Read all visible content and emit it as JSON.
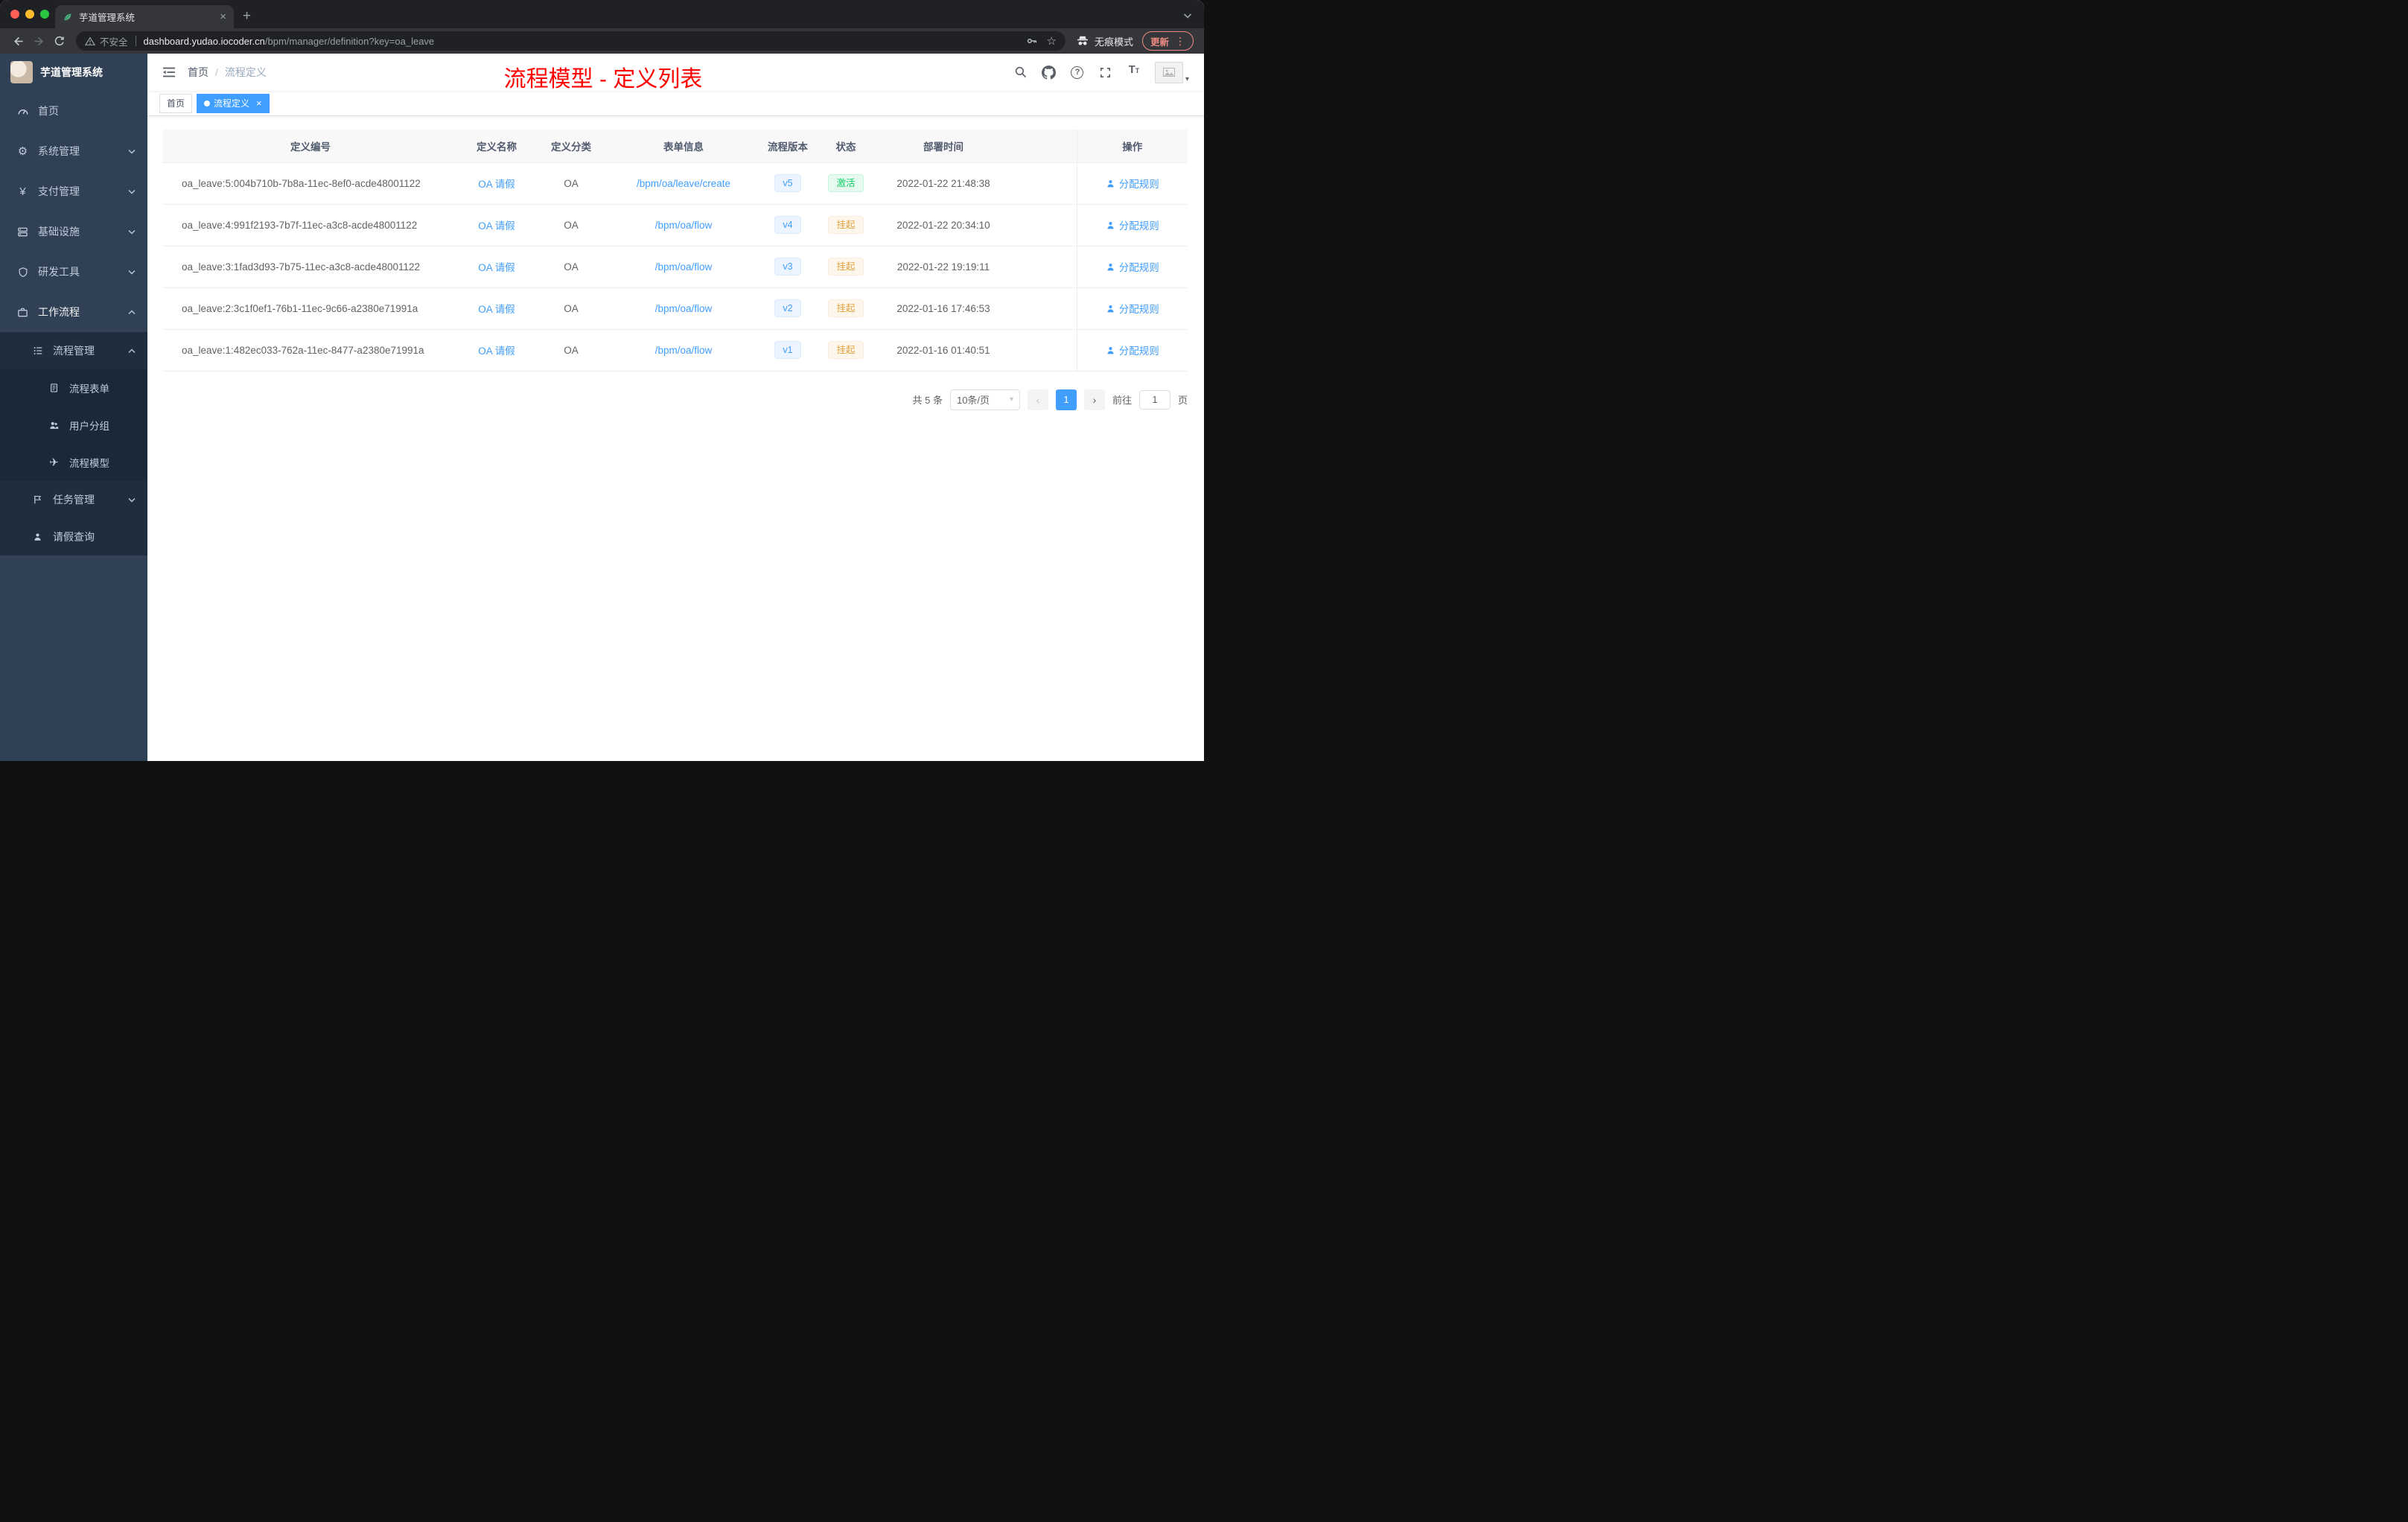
{
  "browser": {
    "tab_title": "芋道管理系统",
    "security_label": "不安全",
    "url_host": "dashboard.yudao.iocoder.cn",
    "url_path": "/bpm/manager/definition?key=oa_leave",
    "incognito_label": "无痕模式",
    "update_label": "更新"
  },
  "sidebar": {
    "logo_title": "芋道管理系统",
    "items": [
      {
        "label": "首页"
      },
      {
        "label": "系统管理"
      },
      {
        "label": "支付管理"
      },
      {
        "label": "基础设施"
      },
      {
        "label": "研发工具"
      },
      {
        "label": "工作流程"
      },
      {
        "label": "流程管理"
      },
      {
        "label": "流程表单"
      },
      {
        "label": "用户分组"
      },
      {
        "label": "流程模型"
      },
      {
        "label": "任务管理"
      },
      {
        "label": "请假查询"
      }
    ]
  },
  "header": {
    "breadcrumb_home": "首页",
    "breadcrumb_separator": "/",
    "breadcrumb_current": "流程定义",
    "overlay_title": "流程模型 - 定义列表"
  },
  "tags": {
    "home": "首页",
    "active": "流程定义"
  },
  "table": {
    "columns": [
      "定义编号",
      "定义名称",
      "定义分类",
      "表单信息",
      "流程版本",
      "状态",
      "部署时间",
      "操作"
    ],
    "rows": [
      {
        "id": "oa_leave:5:004b710b-7b8a-11ec-8ef0-acde48001122",
        "name": "OA 请假",
        "category": "OA",
        "form": "/bpm/oa/leave/create",
        "version": "v5",
        "status": "激活",
        "status_type": "success",
        "time": "2022-01-22 21:48:38",
        "action": "分配规则"
      },
      {
        "id": "oa_leave:4:991f2193-7b7f-11ec-a3c8-acde48001122",
        "name": "OA 请假",
        "category": "OA",
        "form": "/bpm/oa/flow",
        "version": "v4",
        "status": "挂起",
        "status_type": "warning",
        "time": "2022-01-22 20:34:10",
        "action": "分配规则"
      },
      {
        "id": "oa_leave:3:1fad3d93-7b75-11ec-a3c8-acde48001122",
        "name": "OA 请假",
        "category": "OA",
        "form": "/bpm/oa/flow",
        "version": "v3",
        "status": "挂起",
        "status_type": "warning",
        "time": "2022-01-22 19:19:11",
        "action": "分配规则"
      },
      {
        "id": "oa_leave:2:3c1f0ef1-76b1-11ec-9c66-a2380e71991a",
        "name": "OA 请假",
        "category": "OA",
        "form": "/bpm/oa/flow",
        "version": "v2",
        "status": "挂起",
        "status_type": "warning",
        "time": "2022-01-16 17:46:53",
        "action": "分配规则"
      },
      {
        "id": "oa_leave:1:482ec033-762a-11ec-8477-a2380e71991a",
        "name": "OA 请假",
        "category": "OA",
        "form": "/bpm/oa/flow",
        "version": "v1",
        "status": "挂起",
        "status_type": "warning",
        "time": "2022-01-16 01:40:51",
        "action": "分配规则"
      }
    ]
  },
  "pagination": {
    "total_label": "共 5 条",
    "page_size": "10条/页",
    "current": "1",
    "goto_label": "前往",
    "goto_value": "1",
    "page_label": "页"
  },
  "icons": {
    "close_tab": "×",
    "new_tab": "+",
    "star": "☆",
    "menu_dots": "⋮",
    "gear": "⚙",
    "yen": "¥",
    "send": "✈",
    "caret_down": "▾",
    "prev": "‹",
    "next": "›",
    "help": "?",
    "close_tag": "×"
  },
  "colors": {
    "accent": "#409eff",
    "success": "#13ce66",
    "warning": "#e6a23c",
    "title_red": "#ff0000",
    "sidebar_bg": "#304156",
    "submenu_bg": "#1f2d3d"
  }
}
